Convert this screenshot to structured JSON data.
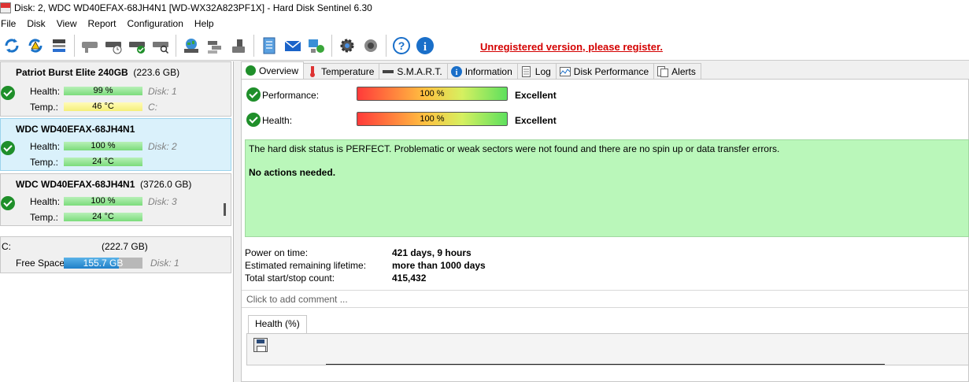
{
  "window": {
    "title": "Disk: 2, WDC WD40EFAX-68JH4N1 [WD-WX32A823PF1X]  -  Hard Disk Sentinel 6.30"
  },
  "menu": [
    "File",
    "Disk",
    "View",
    "Report",
    "Configuration",
    "Help"
  ],
  "toolbar": {
    "icons": [
      "refresh-icon",
      "refresh-warning-icon",
      "disk-details-icon",
      "disk-gray-icon",
      "disk-schedule-icon",
      "disk-check-icon",
      "disk-search-icon",
      "globe-disk-icon",
      "network-disks-icon",
      "usb-drive-icon",
      "notepad-icon",
      "email-icon",
      "network-report-icon",
      "settings-icon",
      "sound-icon",
      "help-icon",
      "info-icon"
    ],
    "notice": "Unregistered version, please register."
  },
  "disks": [
    {
      "name": "Patriot Burst Elite 240GB",
      "capacity": "(223.6 GB)",
      "health_label": "Health:",
      "health": "99 %",
      "health_ref": "Disk: 1",
      "temp_label": "Temp.:",
      "temp": "46 °C",
      "temp_ref": "C:"
    },
    {
      "name": "WDC WD40EFAX-68JH4N1",
      "capacity": "",
      "health_label": "Health:",
      "health": "100 %",
      "health_ref": "Disk: 2",
      "temp_label": "Temp.:",
      "temp": "24 °C",
      "temp_ref": ""
    },
    {
      "name": "WDC WD40EFAX-68JH4N1",
      "capacity": "(3726.0 GB)",
      "health_label": "Health:",
      "health": "100 %",
      "health_ref": "Disk: 3",
      "temp_label": "Temp.:",
      "temp": "24 °C",
      "temp_ref": ""
    }
  ],
  "volume": {
    "letter": "C:",
    "size": "(222.7 GB)",
    "free_label": "Free Space",
    "free": "155.7 GB",
    "free_fraction": 0.7,
    "disk_ref": "Disk: 1"
  },
  "tabs": [
    {
      "label": "Overview",
      "icon": "ok-check-icon"
    },
    {
      "label": "Temperature",
      "icon": "thermometer-icon"
    },
    {
      "label": "S.M.A.R.T.",
      "icon": "smart-disk-icon"
    },
    {
      "label": "Information",
      "icon": "info-icon"
    },
    {
      "label": "Log",
      "icon": "log-icon"
    },
    {
      "label": "Disk Performance",
      "icon": "performance-chart-icon"
    },
    {
      "label": "Alerts",
      "icon": "alerts-icon"
    }
  ],
  "overview": {
    "performance_label": "Performance:",
    "performance_value": "100 %",
    "performance_word": "Excellent",
    "health_label": "Health:",
    "health_value": "100 %",
    "health_word": "Excellent",
    "status_text": "The hard disk status is PERFECT. Problematic or weak sectors were not found and there are no spin up or data transfer errors.",
    "status_action": "No actions needed.",
    "power_on_label": "Power on time:",
    "power_on_value": "421 days, 9 hours",
    "lifetime_label": "Estimated remaining lifetime:",
    "lifetime_value": "more than 1000 days",
    "startstop_label": "Total start/stop count:",
    "startstop_value": "415,432",
    "comment_placeholder": "Click to add comment ...",
    "chart_tab": "Health (%)"
  },
  "colors": {
    "notice": "#d40000",
    "status_bg": "#baf7ba",
    "selected_card": "#daf1fb",
    "ok_green": "#1f8f2a"
  }
}
